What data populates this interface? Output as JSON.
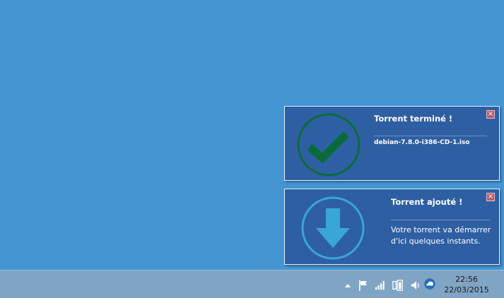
{
  "notifications": [
    {
      "title": "Torrent terminé !",
      "body": "debian-7.8.0-i386-CD-1.iso",
      "icon": "checkmark-circle-icon",
      "close_label": "×",
      "accent": "#0a6b3a"
    },
    {
      "title": "Torrent ajouté !",
      "body": "Votre torrent va démarrer d'ici quelques instants.",
      "icon": "download-arrow-circle-icon",
      "close_label": "×",
      "accent": "#3aa6d6"
    }
  ],
  "taskbar": {
    "tray_icons": [
      "show-hidden-icons-arrow",
      "action-center-flag-icon",
      "network-signal-icon",
      "battery-power-icon",
      "volume-icon",
      "cloud-sync-icon"
    ],
    "clock": {
      "time": "22:56",
      "date": "22/03/2015"
    }
  },
  "colors": {
    "desktop": "#4496d3",
    "toast_bg": "#2e5fa3",
    "taskbar": "#80a4c4"
  }
}
